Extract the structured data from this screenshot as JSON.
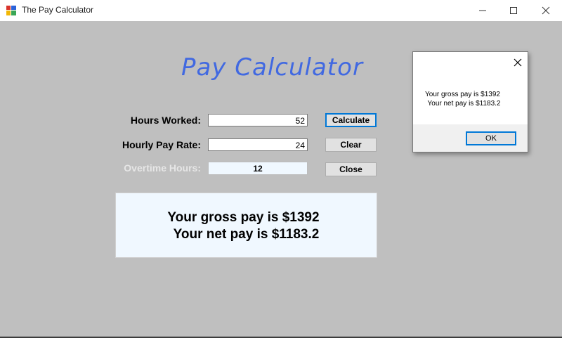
{
  "window": {
    "title": "The Pay Calculator",
    "icon": "app-form-icon"
  },
  "form": {
    "heading": "Pay Calculator",
    "hours_label": "Hours Worked:",
    "hours_value": "52",
    "rate_label": "Hourly Pay Rate:",
    "rate_value": "24",
    "overtime_label": "Overtime Hours:",
    "overtime_value": "12",
    "buttons": {
      "calculate": "Calculate",
      "clear": "Clear",
      "close": "Close"
    },
    "result": {
      "line1": "Your gross pay is $1392",
      "line2": "Your net pay is $1183.2"
    }
  },
  "messagebox": {
    "line1": "Your gross pay is $1392",
    "line2": "Your net pay is $1183.2",
    "ok_label": "OK"
  },
  "colors": {
    "heading": "#4169e1",
    "background": "#bfbfbf",
    "panel": "#f0f8ff",
    "focus_border": "#0078d7"
  }
}
